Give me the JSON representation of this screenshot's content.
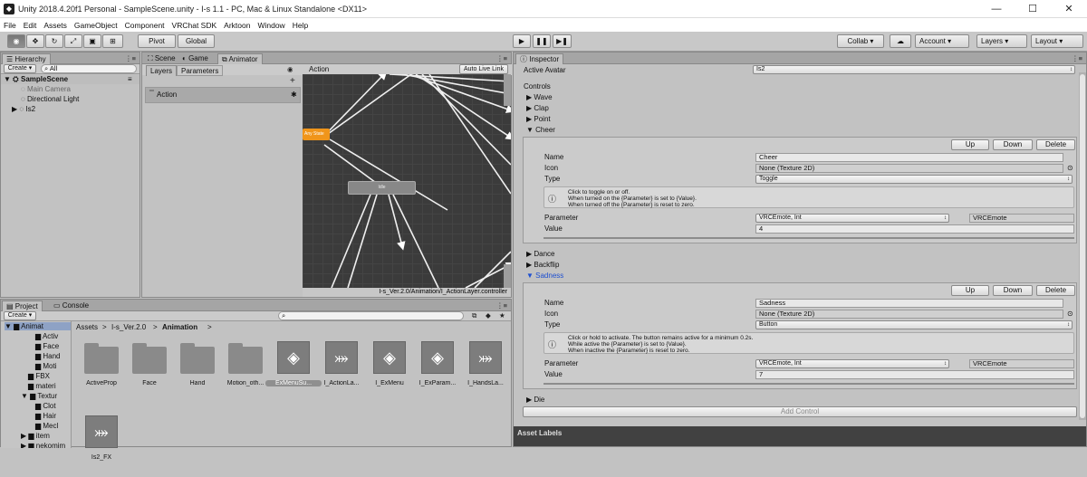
{
  "window": {
    "title": "Unity 2018.4.20f1 Personal - SampleScene.unity - I-s 1.1 - PC, Mac & Linux Standalone <DX11>",
    "minimize": "—",
    "maximize": "☐",
    "close": "✕"
  },
  "menu": [
    "File",
    "Edit",
    "Assets",
    "GameObject",
    "Component",
    "VRChat SDK",
    "Arktoon",
    "Window",
    "Help"
  ],
  "toolbar": {
    "pivot": "Pivot",
    "global": "Global",
    "collab": "Collab ▾",
    "account": "Account",
    "layers": "Layers",
    "layout": "Layout"
  },
  "hierarchy": {
    "tab": "Hierarchy",
    "create": "Create ▾",
    "search": "All",
    "scene": "SampleScene",
    "items": [
      "Main Camera",
      "Directional Light",
      "Is2"
    ]
  },
  "center_tabs": {
    "scene": "Scene",
    "game": "Game",
    "animator": "Animator"
  },
  "animator": {
    "layers_tab": "Layers",
    "params_tab": "Parameters",
    "layer": "Action",
    "breadcrumb": "Action",
    "auto_live": "Auto Live Link",
    "path": "I-s_Ver.2.0/Animation/I_ActionLayer.controller",
    "node_orange": "Any State",
    "node_grey": "Idle"
  },
  "project": {
    "tab": "Project",
    "console": "Console",
    "create": "Create ▾",
    "breadcrumb": [
      "Assets",
      "I-s_Ver.2.0",
      "Animation"
    ],
    "tree": [
      "Animat",
      "Activ",
      "Face",
      "Hand",
      "Moti",
      "FBX",
      "materi",
      "Textur",
      "Clot",
      "Hair",
      "Mecl",
      "item",
      "nekomim"
    ],
    "assets": [
      {
        "name": "ActiveProp",
        "kind": "folder"
      },
      {
        "name": "Face",
        "kind": "folder"
      },
      {
        "name": "Hand",
        "kind": "folder"
      },
      {
        "name": "Motion_oth...",
        "kind": "folder"
      },
      {
        "name": "ExMenuSu...",
        "kind": "unity"
      },
      {
        "name": "I_ActionLa...",
        "kind": "anim"
      },
      {
        "name": "I_ExMenu",
        "kind": "unity"
      },
      {
        "name": "I_ExParam...",
        "kind": "unity"
      },
      {
        "name": "I_HandsLa...",
        "kind": "anim"
      },
      {
        "name": "Is2_FX",
        "kind": "anim"
      }
    ]
  },
  "inspector": {
    "tab": "Inspector",
    "active_avatar_label": "Active Avatar",
    "active_avatar": "Is2",
    "controls": "Controls",
    "items": [
      "Wave",
      "Clap",
      "Point",
      "Cheer",
      "Dance",
      "Backflip",
      "Sadness",
      "Die"
    ],
    "up": "Up",
    "down": "Down",
    "delete": "Delete",
    "cheer": {
      "name_label": "Name",
      "name": "Cheer",
      "icon_label": "Icon",
      "icon": "None (Texture 2D)",
      "type_label": "Type",
      "type": "Toggle",
      "help": [
        "Click to toggle on or off.",
        "When turned on the {Parameter} is set to {Value}.",
        "When turned off the {Parameter} is reset to zero."
      ],
      "param_label": "Parameter",
      "param": "VRCEmote, Int",
      "param_name": "VRCEmote",
      "value_label": "Value",
      "value": "4"
    },
    "sadness": {
      "name_label": "Name",
      "name": "Sadness",
      "icon_label": "Icon",
      "icon": "None (Texture 2D)",
      "type_label": "Type",
      "type": "Button",
      "help": [
        "Click or hold to activate. The button remains active for a minimum 0.2s.",
        "While active the {Parameter} is set to {Value}.",
        "When inactive the {Parameter} is reset to zero."
      ],
      "param_label": "Parameter",
      "param": "VRCEmote, Int",
      "param_name": "VRCEmote",
      "value_label": "Value",
      "value": "7"
    },
    "add_control": "Add Control",
    "asset_labels": "Asset Labels"
  }
}
